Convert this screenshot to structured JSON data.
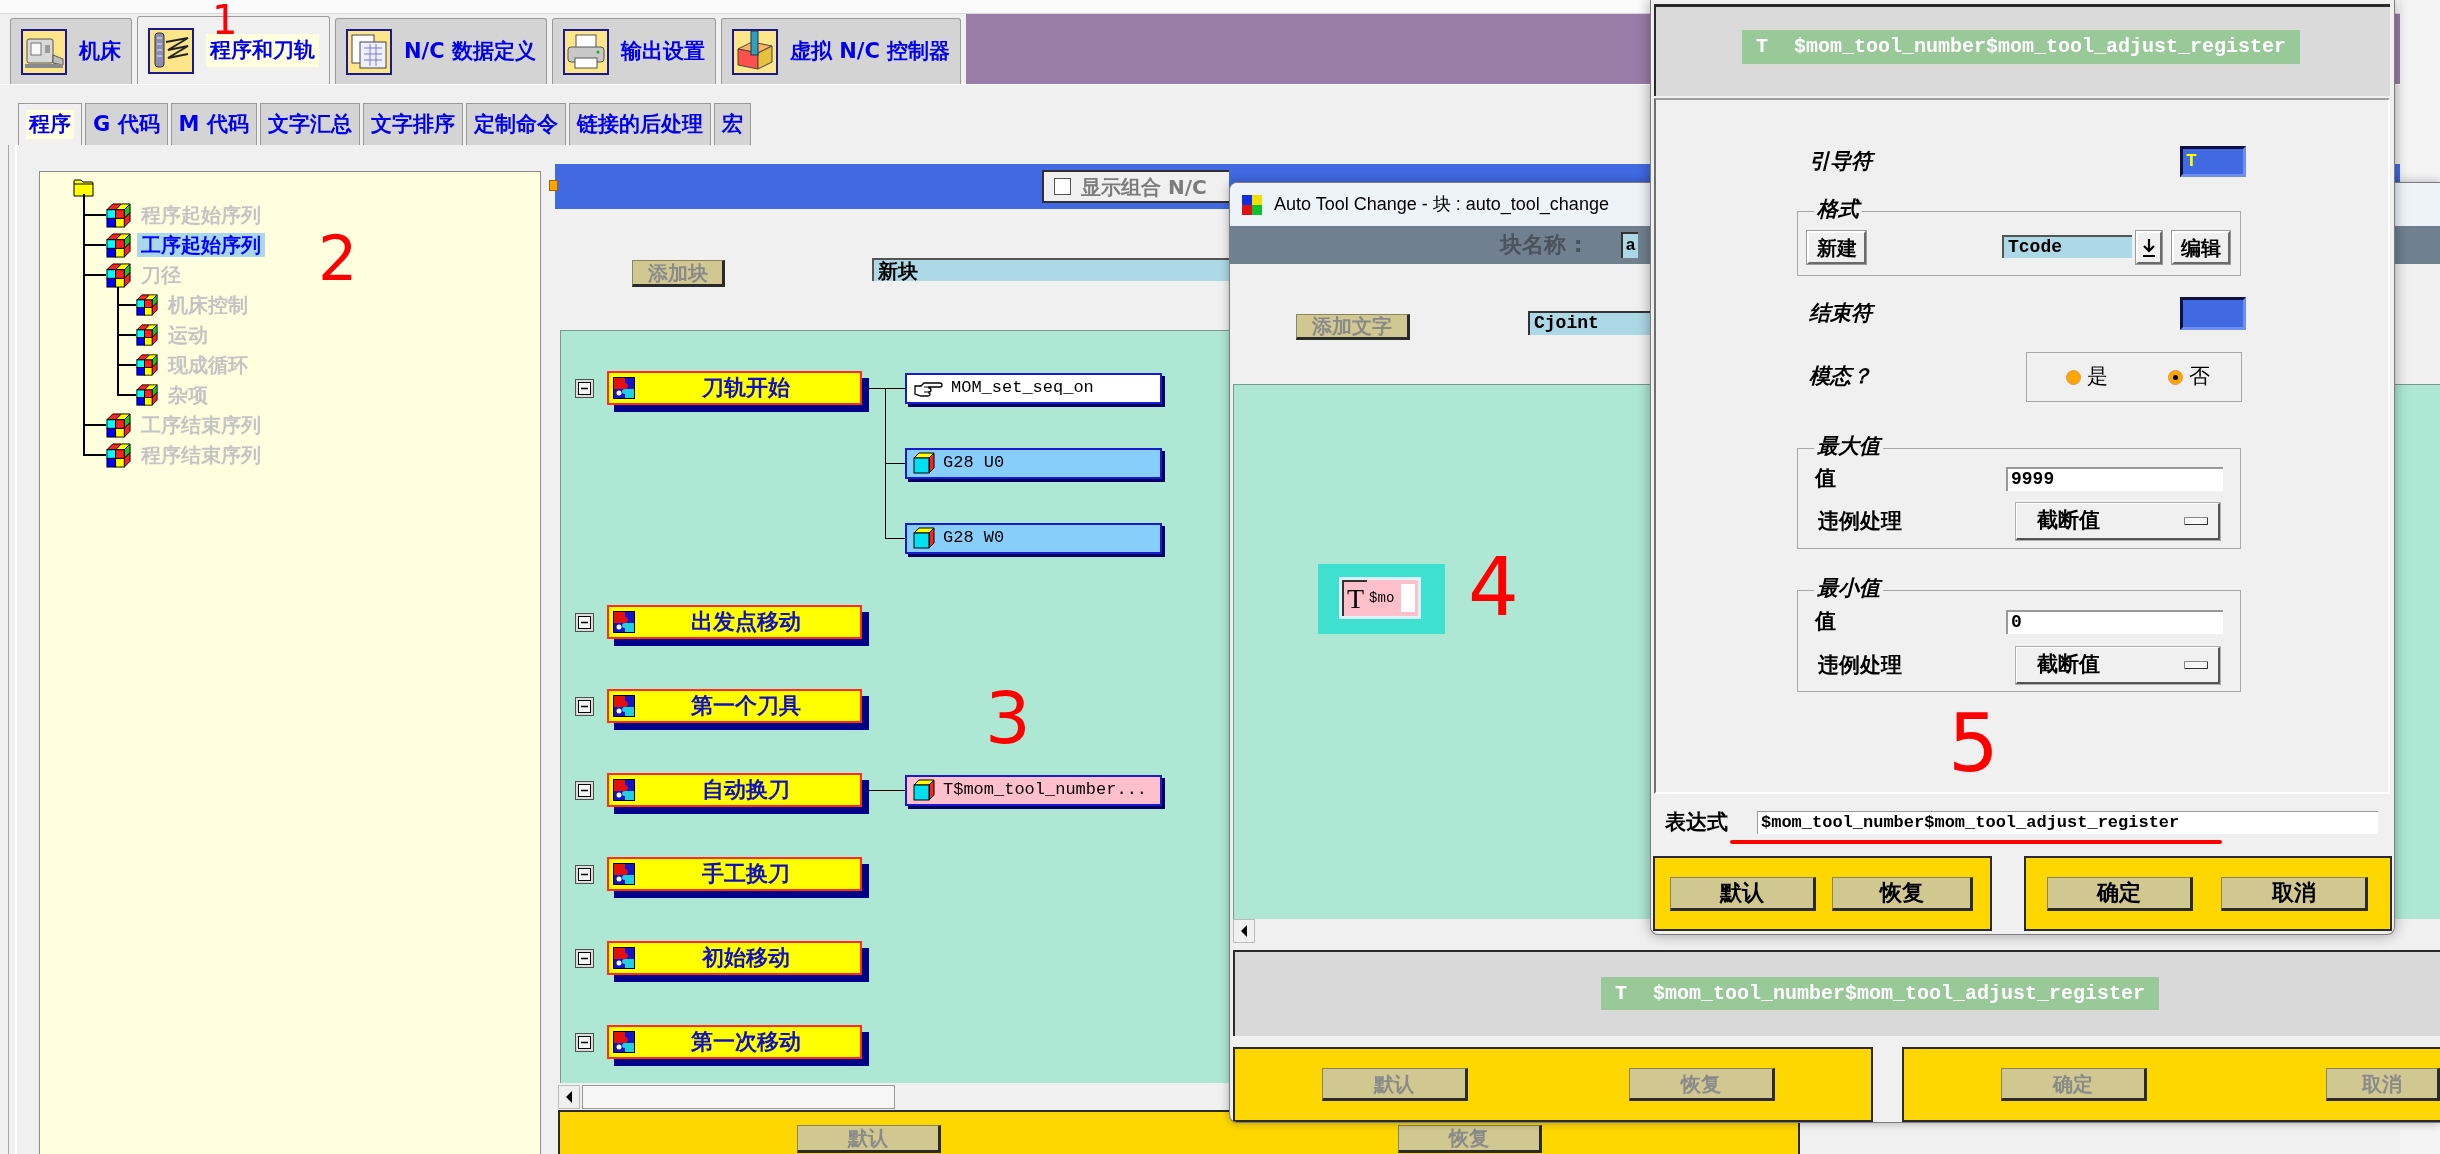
{
  "main_window": {
    "tabs": [
      {
        "label": "机床",
        "selected": false
      },
      {
        "label": "程序和刀轨",
        "selected": true
      },
      {
        "label": "N/C 数据定义",
        "selected": false
      },
      {
        "label": "输出设置",
        "selected": false
      },
      {
        "label": "虚拟 N/C 控制器",
        "selected": false
      }
    ],
    "subtabs": [
      {
        "label": "程序",
        "selected": true
      },
      {
        "label": "G 代码",
        "selected": false
      },
      {
        "label": "M 代码",
        "selected": false
      },
      {
        "label": "文字汇总",
        "selected": false
      },
      {
        "label": "文字排序",
        "selected": false
      },
      {
        "label": "定制命令",
        "selected": false
      },
      {
        "label": "链接的后处理",
        "selected": false
      },
      {
        "label": "宏",
        "selected": false
      }
    ],
    "tree": {
      "children": [
        {
          "label": "程序起始序列",
          "selected": false
        },
        {
          "label": "工序起始序列",
          "selected": true
        },
        {
          "label": "刀径",
          "selected": false,
          "children": [
            {
              "label": "机床控制",
              "selected": false
            },
            {
              "label": "运动",
              "selected": false
            },
            {
              "label": "现成循环",
              "selected": false
            },
            {
              "label": "杂项",
              "selected": false
            }
          ]
        },
        {
          "label": "工序结束序列",
          "selected": false
        },
        {
          "label": "程序结束序列",
          "selected": false
        }
      ]
    },
    "combined_nc_checkbox": {
      "label": "显示组合 N/C",
      "checked": false
    },
    "add_block_button": {
      "label": "添加块",
      "disabled": true
    },
    "new_block_field": {
      "value": "新块"
    },
    "sequence": [
      {
        "label": "刀轨开始",
        "expanded": true,
        "words": [
          {
            "kind": "command",
            "text": "MOM_set_seq_on",
            "selected": false
          },
          {
            "kind": "block",
            "text": "G28 U0",
            "selected": false
          },
          {
            "kind": "block",
            "text": "G28 W0",
            "selected": false
          }
        ]
      },
      {
        "label": "出发点移动",
        "expanded": true
      },
      {
        "label": "第一个刀具",
        "expanded": true
      },
      {
        "label": "自动换刀",
        "expanded": true,
        "words": [
          {
            "kind": "block",
            "text": "T$mom_tool_number...",
            "selected": true
          }
        ]
      },
      {
        "label": "手工换刀",
        "expanded": true
      },
      {
        "label": "初始移动",
        "expanded": true
      },
      {
        "label": "第一次移动",
        "expanded": true
      }
    ],
    "footer_buttons": [
      {
        "label": "默认",
        "disabled": true
      },
      {
        "label": "恢复",
        "disabled": true
      }
    ]
  },
  "block_dialog": {
    "title": "Auto Tool Change - 块 : auto_tool_change",
    "block_name": {
      "label": "块名称 :",
      "value": "a"
    },
    "add_word_button": {
      "label": "添加文字",
      "disabled": true
    },
    "word_field": {
      "value": "Cjoint"
    },
    "words": [
      {
        "leader": "T",
        "text": "$mo",
        "selected": true
      }
    ],
    "preview": {
      "leader": "T",
      "expression": "$mom_tool_number$mom_tool_adjust_register"
    },
    "left_buttons": [
      {
        "label": "默认",
        "disabled": true
      },
      {
        "label": "恢复",
        "disabled": true
      }
    ],
    "right_buttons": [
      {
        "label": "确定",
        "disabled": true
      },
      {
        "label": "取消",
        "disabled": true
      }
    ]
  },
  "word_dialog": {
    "preview": {
      "leader": "T",
      "expression": "$mom_tool_number$mom_tool_adjust_register"
    },
    "leader_field": {
      "label": "引导符",
      "value": "T"
    },
    "format": {
      "title": "格式",
      "new_button": "新建",
      "value": "Tcode",
      "edit_button": "编辑"
    },
    "trailer_field": {
      "label": "结束符"
    },
    "modal": {
      "label": "模态？",
      "options": [
        {
          "label": "是",
          "selected": false
        },
        {
          "label": "否",
          "selected": true
        }
      ]
    },
    "maximum": {
      "title": "最大值",
      "value_label": "值",
      "value": "9999",
      "violation_label": "违例处理",
      "violation": "截断值"
    },
    "minimum": {
      "title": "最小值",
      "value_label": "值",
      "value": "0",
      "violation_label": "违例处理",
      "violation": "截断值"
    },
    "expression": {
      "label": "表达式",
      "value": "$mom_tool_number$mom_tool_adjust_register"
    },
    "left_buttons": [
      {
        "label": "默认",
        "disabled": false
      },
      {
        "label": "恢复",
        "disabled": false
      }
    ],
    "right_buttons": [
      {
        "label": "确定",
        "disabled": false
      },
      {
        "label": "取消",
        "disabled": false
      }
    ]
  },
  "annotations": [
    {
      "kind": "numeral",
      "text": "1"
    },
    {
      "kind": "numeral",
      "text": "2"
    },
    {
      "kind": "numeral",
      "text": "3"
    },
    {
      "kind": "numeral",
      "text": "4"
    },
    {
      "kind": "numeral",
      "text": "5"
    },
    {
      "kind": "underline"
    }
  ]
}
